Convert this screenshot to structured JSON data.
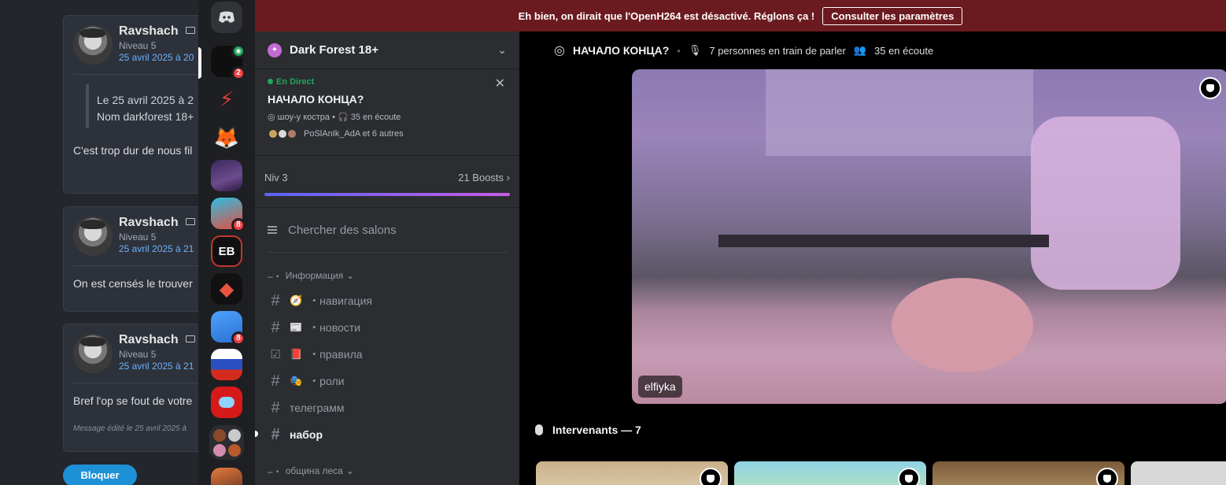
{
  "forum": {
    "posts": [
      {
        "user": "Ravshach",
        "level": "Niveau 5",
        "date": "25 avril 2025 à 20",
        "quote_lines": [
          "Le 25 avril 2025 à 2",
          "Nom darkforest 18+"
        ],
        "body": "C'est trop dur de nous fil"
      },
      {
        "user": "Ravshach",
        "level": "Niveau 5",
        "date": "25 avril 2025 à 21",
        "body": "On est censés le trouver"
      },
      {
        "user": "Ravshach",
        "level": "Niveau 5",
        "date": "25 avril 2025 à 21",
        "body": "Bref l'op se fout de votre",
        "edited": "Message édité le 25 avril 2025 à"
      }
    ],
    "block_button": "Bloquer"
  },
  "rail": {
    "servers": [
      {
        "icon": "discord-icon"
      },
      {
        "icon": "server-icon",
        "badge": "2",
        "voice": true
      },
      {
        "icon": "server-icon",
        "symbol": "⚡"
      },
      {
        "icon": "server-icon",
        "symbol": "🦊"
      },
      {
        "icon": "server-icon"
      },
      {
        "icon": "server-icon",
        "badge": "8"
      },
      {
        "icon": "server-icon",
        "symbol": "EB"
      },
      {
        "icon": "server-icon",
        "symbol": "◆"
      },
      {
        "icon": "server-icon",
        "badge": "8"
      },
      {
        "icon": "server-icon"
      },
      {
        "icon": "server-icon"
      },
      {
        "icon": "server-icon"
      },
      {
        "icon": "server-icon"
      }
    ]
  },
  "banner": {
    "message": "Eh bien, on dirait que l'OpenH264 est désactivé. Réglons ça !",
    "action": "Consulter les paramètres"
  },
  "sidebar": {
    "server_name": "Dark Forest 18+",
    "live": {
      "tag": "En Direct",
      "title": "НАЧАЛО КОНЦА?",
      "host": "шоу-у костра",
      "listeners": "35 en écoute",
      "people": "PoSlAnIk_AdA et 6 autres"
    },
    "level": {
      "label": "Niv 3",
      "boosts": "21 Boosts"
    },
    "search_placeholder": "Chercher des salons",
    "categories": [
      {
        "name": "Информация",
        "channels": [
          {
            "emoji": "🧭",
            "name": "・навигация"
          },
          {
            "emoji": "📰",
            "name": "・новости"
          },
          {
            "emoji": "📕",
            "name": "・правила",
            "rules": true
          },
          {
            "emoji": "🎭",
            "name": "・роли"
          },
          {
            "emoji": "",
            "name": "телеграмм"
          },
          {
            "emoji": "",
            "name": "набор",
            "active": true
          }
        ]
      },
      {
        "name": "община леса",
        "channels": []
      }
    ]
  },
  "stage": {
    "title": "НАЧАЛО КОНЦА?",
    "speaking": "7 personnes en train de parler",
    "listening": "35 en écoute",
    "video_user": "elfiyka",
    "speakers_label": "Intervenants — 7"
  },
  "colors": {
    "banner": "#6b1a1f",
    "accent": "#5865f2",
    "link": "#6ab1ff",
    "live": "#23a55a",
    "badge": "#f23f43"
  }
}
